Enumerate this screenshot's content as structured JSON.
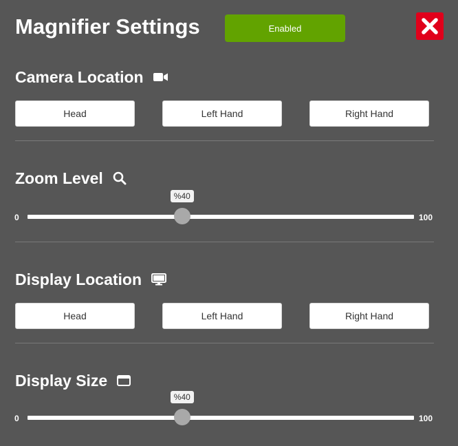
{
  "header": {
    "title": "Magnifier Settings",
    "enabled_label": "Enabled",
    "close_icon": "close-icon",
    "accent_green": "#62a300",
    "close_red": "#e0001b"
  },
  "camera_location": {
    "title": "Camera Location",
    "icon": "video-camera-icon",
    "options": [
      "Head",
      "Left Hand",
      "Right Hand"
    ]
  },
  "zoom_level": {
    "title": "Zoom Level",
    "icon": "search-icon",
    "min_label": "0",
    "max_label": "100",
    "value": 40,
    "value_label": "%40"
  },
  "display_location": {
    "title": "Display Location",
    "icon": "monitor-icon",
    "options": [
      "Head",
      "Left Hand",
      "Right Hand"
    ]
  },
  "display_size": {
    "title": "Display Size",
    "icon": "window-icon",
    "min_label": "0",
    "max_label": "100",
    "value": 40,
    "value_label": "%40"
  }
}
